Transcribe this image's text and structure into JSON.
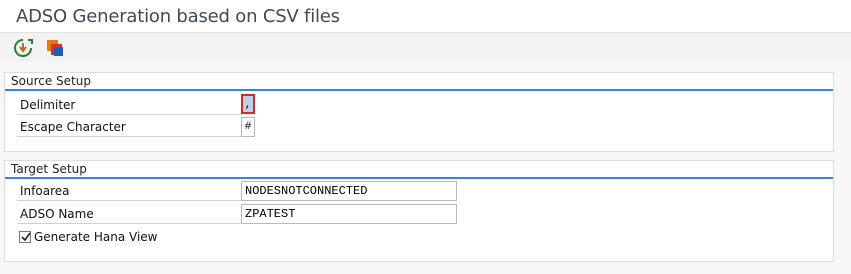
{
  "window": {
    "title": "ADSO Generation based on CSV files"
  },
  "toolbar": {
    "buttons": [
      {
        "icon": "execute-icon"
      },
      {
        "icon": "copy-icon"
      }
    ]
  },
  "source_setup": {
    "title": "Source Setup",
    "delimiter": {
      "label": "Delimiter",
      "value": ","
    },
    "escape_character": {
      "label": "Escape Character",
      "value": "#"
    }
  },
  "target_setup": {
    "title": "Target Setup",
    "infoarea": {
      "label": "Infoarea",
      "value": "NODESNOTCONNECTED"
    },
    "adso_name": {
      "label": "ADSO Name",
      "value": "ZPATEST"
    },
    "generate_hana_view": {
      "label": "Generate Hana View",
      "checked": true
    }
  },
  "colors": {
    "accent": "#2d8cc9",
    "focus": "#d22b2b"
  }
}
